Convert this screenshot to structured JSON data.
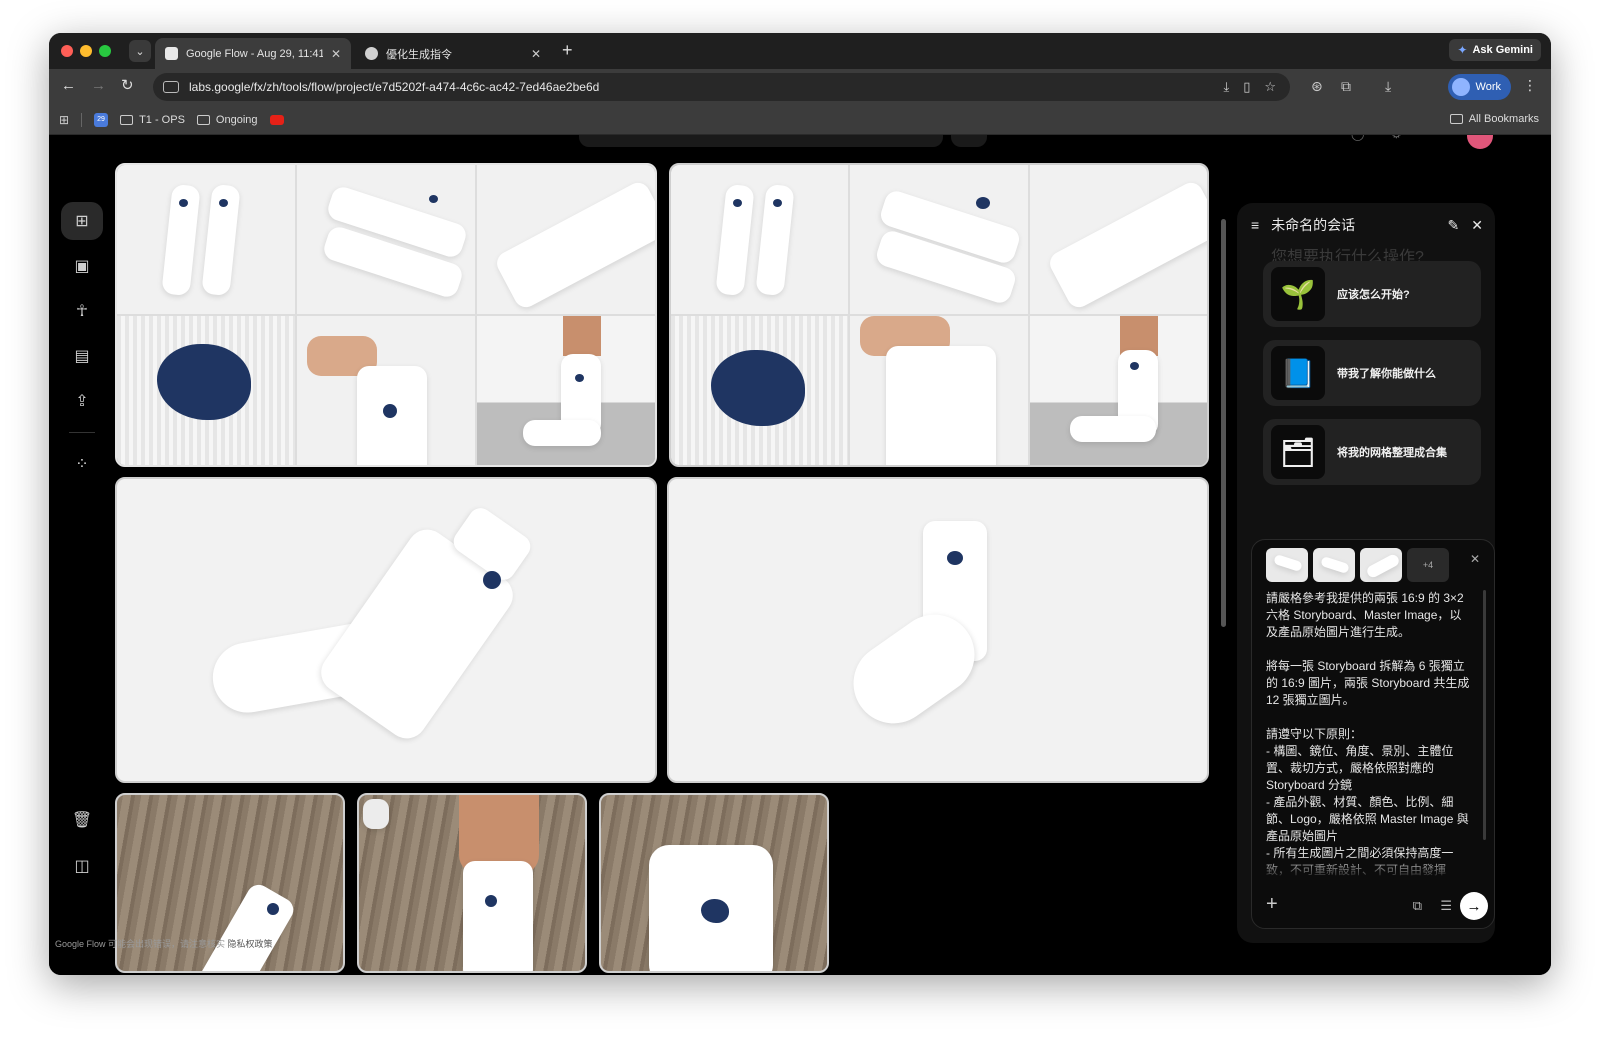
{
  "browser": {
    "tabs": [
      {
        "title": "Google Flow - Aug 29, 11:41 /",
        "active": true
      },
      {
        "title": "優化生成指令",
        "active": false
      }
    ],
    "ask_gemini": "Ask Gemini",
    "url": "labs.google/fx/zh/tools/flow/project/e7d5202f-a474-4c6c-ac42-7ed46ae2be6d",
    "profile": "Work",
    "bookmarks": [
      {
        "label": "T1 - OPS",
        "icon": "folder-icon"
      },
      {
        "label": "Ongoing",
        "icon": "folder-icon"
      }
    ],
    "calendar_day": "29",
    "all_bookmarks": "All Bookmarks"
  },
  "rail": {
    "items": [
      "grid-view-icon",
      "image-icon",
      "character-icon",
      "scene-clapper-icon",
      "upload-folder-icon",
      "sparkle-grid-icon"
    ],
    "bottom": [
      "trash-icon",
      "panel-toggle-icon"
    ]
  },
  "chat": {
    "title": "未命名的会话",
    "ghost_prompt": "您想要执行什么操作?",
    "suggestions": [
      {
        "label": "应该怎么开始?",
        "icon": "seedling-icon"
      },
      {
        "label": "带我了解你能做什么",
        "icon": "book-icon"
      },
      {
        "label": "将我的网格整理成合集",
        "icon": "folder-collection-icon"
      }
    ],
    "attachments_more": "+4",
    "prompt_text": "請嚴格參考我提供的兩張 16:9 的 3×2 六格 Storyboard、Master Image，以及產品原始圖片進行生成。\n\n將每一張 Storyboard 拆解為 6 張獨立的 16:9 圖片，兩張 Storyboard 共生成 12 張獨立圖片。\n\n請遵守以下原則：\n- 構圖、鏡位、角度、景別、主體位置、裁切方式，嚴格依照對應的 Storyboard 分鏡\n- 產品外觀、材質、顏色、比例、細節、Logo，嚴格依照 Master Image 與產品原始圖片\n- 所有生成圖片之間必須保持高度一致，不可重新設計、不可自由發揮\n- 與原圖一一對應，不可合併、不可遺漏"
  },
  "footer": {
    "text": "Google Flow 可能会出现错误，请注意核实",
    "extra": "隐私权政策"
  },
  "colors": {
    "accent_logo_dot": "#1f3562",
    "avatar": "#e0567a",
    "work_profile": "#2f5fb3"
  }
}
